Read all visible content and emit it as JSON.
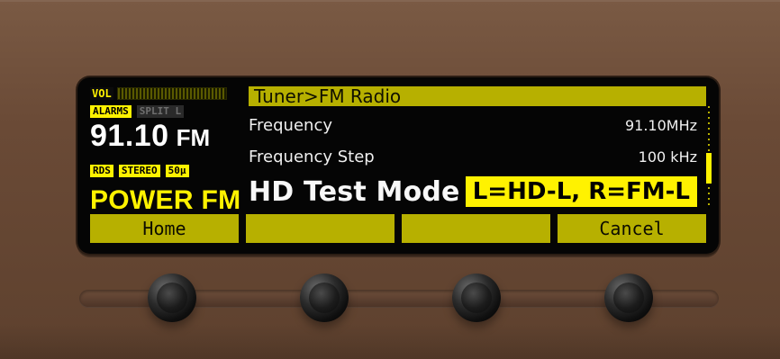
{
  "status": {
    "vol_label": "VOL",
    "alarms_label": "ALARMS",
    "split_label": "SPLIT L",
    "rds_label": "RDS",
    "stereo_label": "STEREO",
    "deemph_label": "50μ"
  },
  "tuner": {
    "frequency_number": "91.10",
    "frequency_unit": "FM",
    "station_name": "POWER FM"
  },
  "menu": {
    "breadcrumb": "Tuner>FM Radio",
    "rows": [
      {
        "label": "Frequency",
        "value": "91.10MHz"
      },
      {
        "label": "Frequency Step",
        "value": "100 kHz"
      },
      {
        "label": "HD Test Mode",
        "value": "L=HD-L, R=FM-L"
      }
    ]
  },
  "softkeys": [
    {
      "label": "Home"
    },
    {
      "label": ""
    },
    {
      "label": ""
    },
    {
      "label": "Cancel"
    }
  ],
  "colors": {
    "accent_yellow": "#fff200",
    "lcd_olive": "#b7b000",
    "panel_brown": "#6a4a36"
  },
  "icons": {
    "vol_meter": "volume-meter-icon",
    "scrollbar": "scrollbar-icon",
    "knob": "rotary-knob-icon"
  }
}
